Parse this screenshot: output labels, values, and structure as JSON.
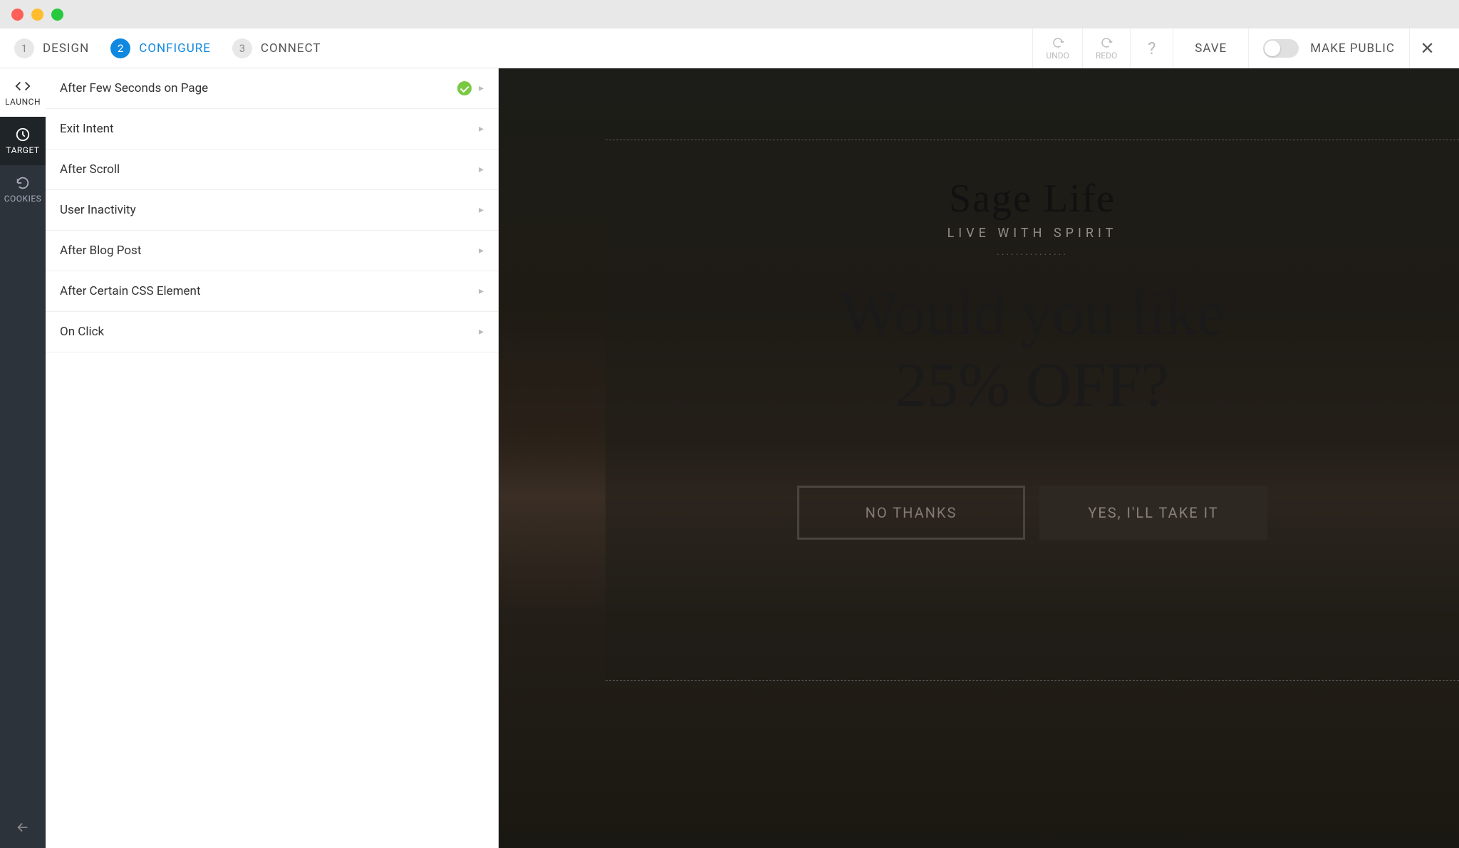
{
  "steps": [
    {
      "num": "1",
      "label": "DESIGN",
      "active": false
    },
    {
      "num": "2",
      "label": "CONFIGURE",
      "active": true
    },
    {
      "num": "3",
      "label": "CONNECT",
      "active": false
    }
  ],
  "topbar": {
    "undo": "UNDO",
    "redo": "REDO",
    "help": "?",
    "save": "SAVE",
    "publish": "MAKE PUBLIC",
    "close": "✕"
  },
  "sidebar": {
    "launch": "LAUNCH",
    "target": "TARGET",
    "cookies": "COOKIES"
  },
  "triggers": [
    {
      "label": "After Few Seconds on Page",
      "enabled": true
    },
    {
      "label": "Exit Intent",
      "enabled": false
    },
    {
      "label": "After Scroll",
      "enabled": false
    },
    {
      "label": "User Inactivity",
      "enabled": false
    },
    {
      "label": "After Blog Post",
      "enabled": false
    },
    {
      "label": "After Certain CSS Element",
      "enabled": false
    },
    {
      "label": "On Click",
      "enabled": false
    }
  ],
  "preview": {
    "logo": "Sage Life",
    "tagline": "LIVE WITH SPIRIT",
    "headline_line1": "Would you like",
    "headline_line2": "25% OFF?",
    "btn_no": "NO THANKS",
    "btn_yes": "YES, I'LL TAKE IT"
  }
}
